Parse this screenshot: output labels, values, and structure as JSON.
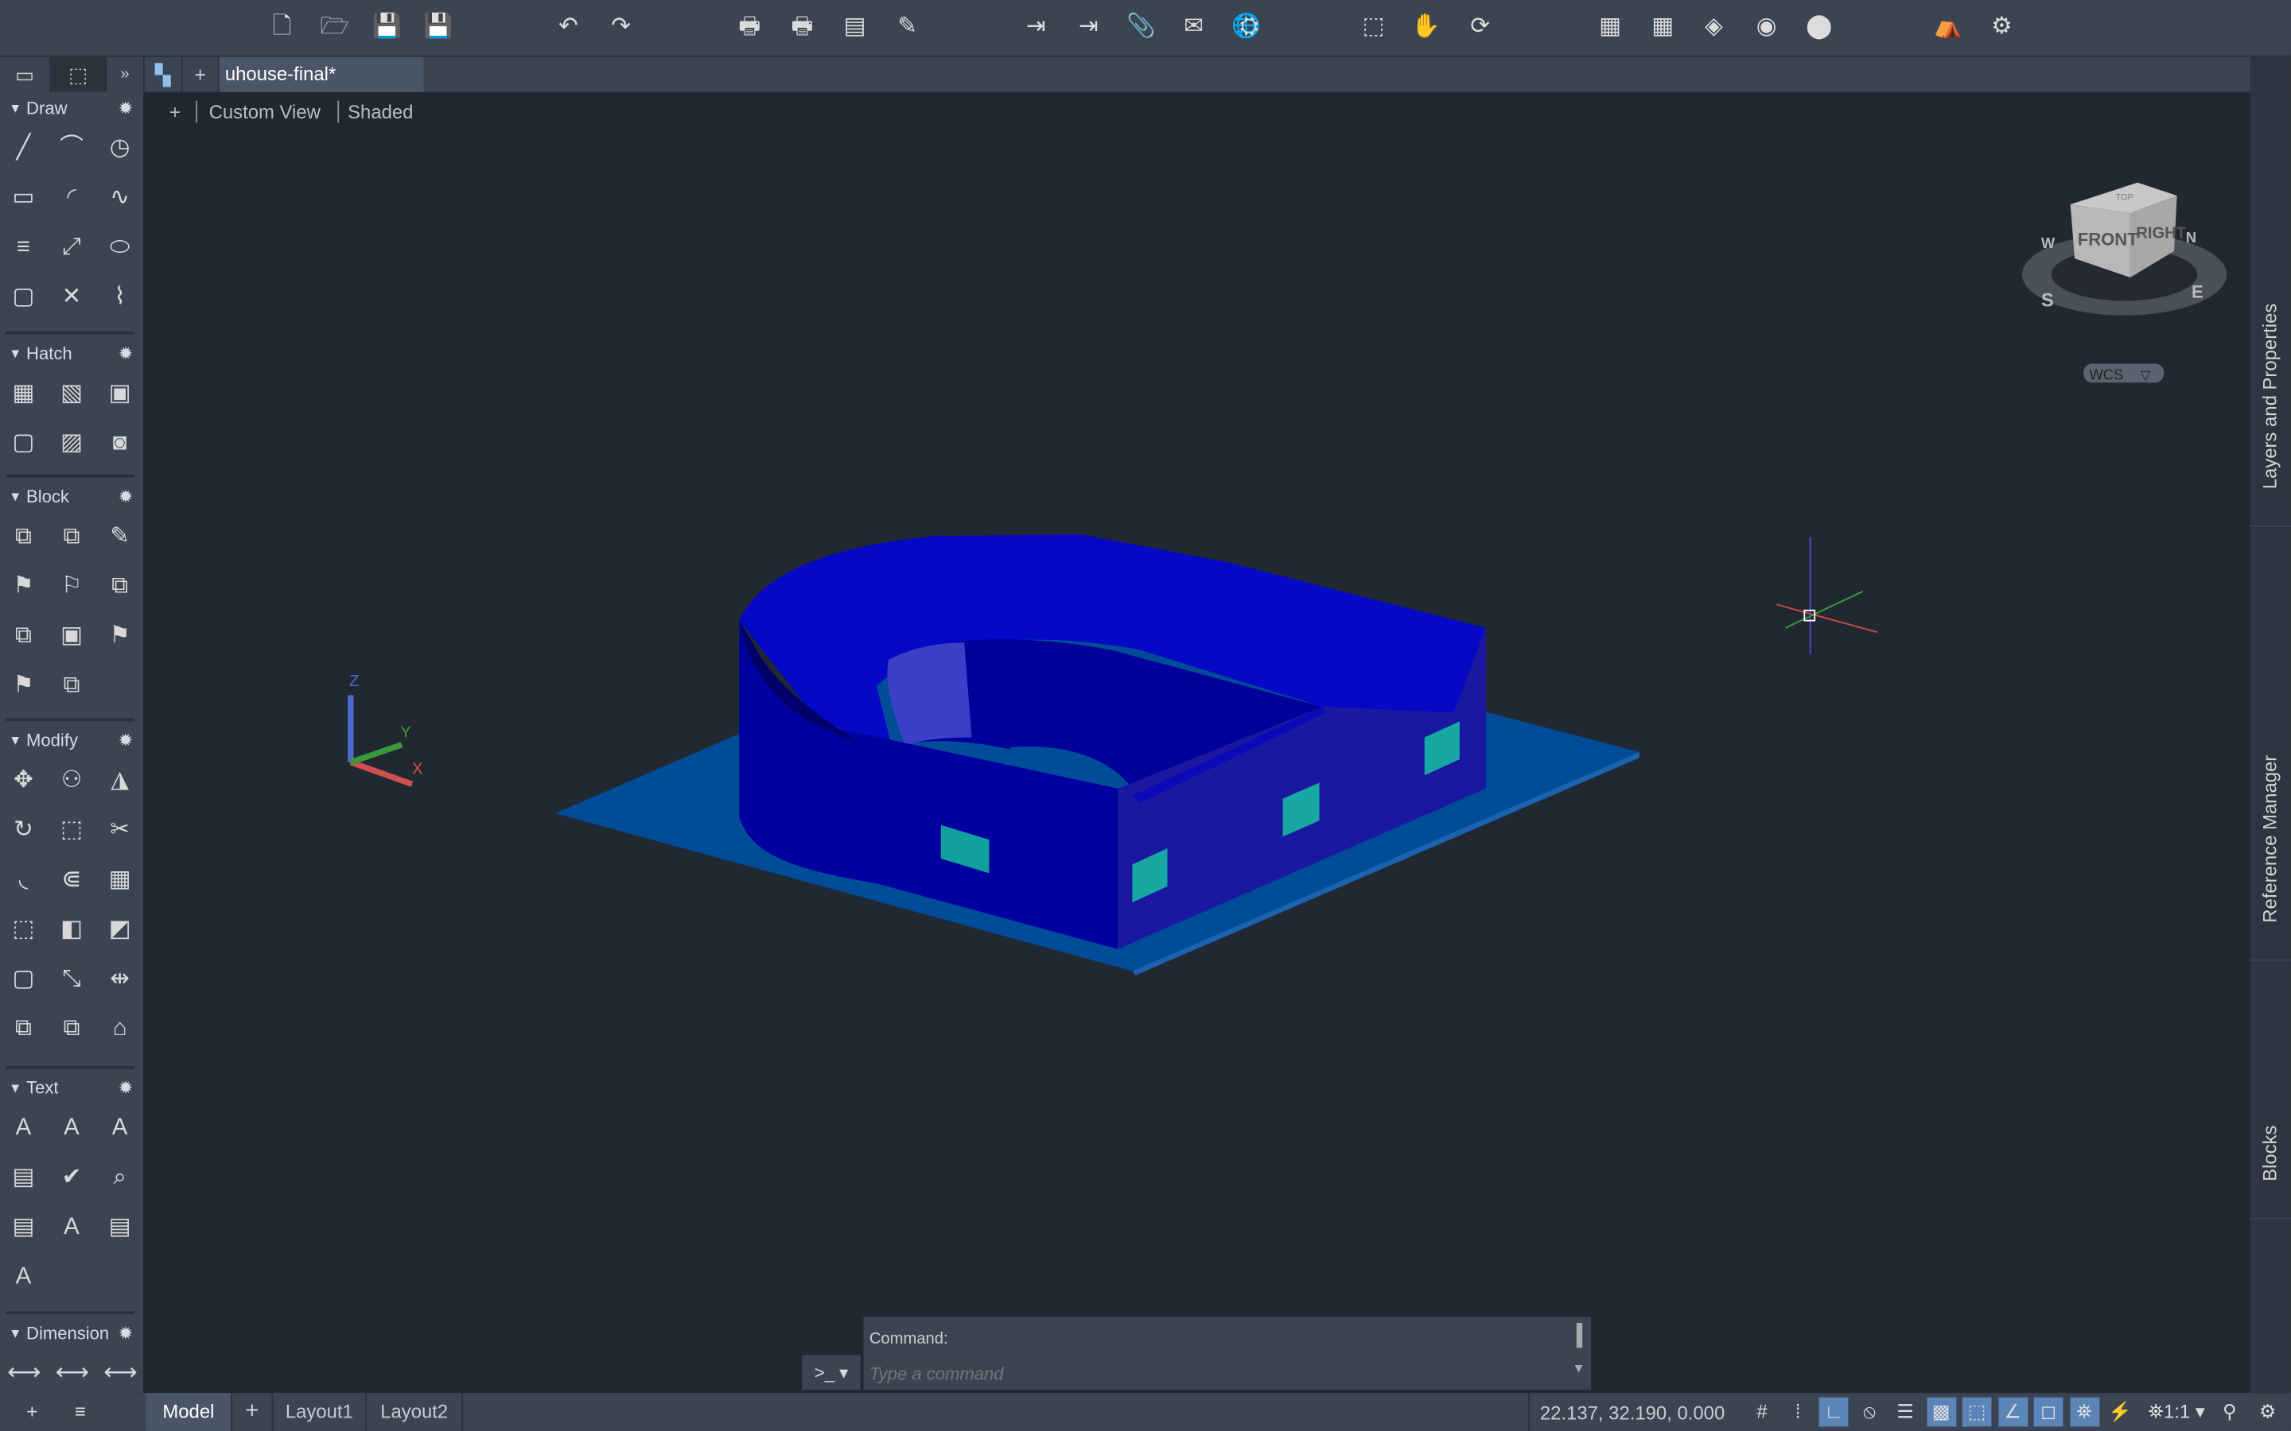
{
  "toolbar": {
    "icons": [
      "new-file",
      "open-file",
      "save",
      "save-as",
      "undo",
      "redo",
      "plot",
      "batch-plot",
      "page-setup",
      "plot-style-editor",
      "import",
      "export",
      "attach",
      "etransmit",
      "publish-web",
      "share",
      "zoom-window",
      "pan",
      "orbit",
      "properties",
      "match-properties",
      "layer-states",
      "layer-manager",
      "color-book",
      "render",
      "render-settings"
    ]
  },
  "tabs": {
    "document": "uhouse-final*",
    "add": "+"
  },
  "viewport": {
    "view_control": "+",
    "view_name": "Custom View",
    "visual_style": "Shaded",
    "wcs": "WCS",
    "viewcube": {
      "front": "FRONT",
      "right": "RIGHT",
      "top": "TOP",
      "north": "N",
      "south": "S",
      "east": "E",
      "west": "W"
    },
    "ucs": {
      "x": "X",
      "y": "Y",
      "z": "Z"
    }
  },
  "palette": {
    "sections": [
      {
        "title": "Draw",
        "icons": [
          "line-icon",
          "polyline-icon",
          "circle-icon",
          "rectangle-icon",
          "arc-icon",
          "spline-icon",
          "multiline-icon",
          "ray-icon",
          "ellipse-icon",
          "rounded-rect-icon",
          "construction-line-icon",
          "revcloud-icon"
        ]
      },
      {
        "title": "Hatch",
        "icons": [
          "hatch-icon",
          "gradient-icon",
          "boundary-icon",
          "region-icon",
          "wipeout-icon",
          "fill-icon"
        ]
      },
      {
        "title": "Block",
        "icons": [
          "create-block-icon",
          "insert-block-icon",
          "edit-block-icon",
          "define-attribute-icon",
          "attribute-tag-icon",
          "block-attribute-manager-icon",
          "write-block-icon",
          "base-point-icon",
          "sync-attributes-icon",
          "edit-attribute-icon",
          "attribute-extract-icon"
        ]
      },
      {
        "title": "Modify",
        "icons": [
          "move-icon",
          "copy-icon",
          "mirror-icon",
          "rotate-icon",
          "stretch-icon",
          "trim-icon",
          "fillet-icon",
          "offset-icon",
          "array-icon",
          "3d-box-icon",
          "align-icon",
          "draworder-icon",
          "scale-icon",
          "extend-icon",
          "join-icon",
          "edit-reference-icon",
          "copy-reference-icon",
          "erase-icon"
        ]
      },
      {
        "title": "Text",
        "icons": [
          "text-icon",
          "text-style-icon",
          "annotative-text-icon",
          "mtext-icon",
          "spellcheck-icon",
          "find-icon",
          "table-text-icon",
          "update-fields-icon",
          "pdf-import-icon",
          "pdf-text-icon"
        ]
      },
      {
        "title": "Dimension",
        "icons": [
          "quick-dimension-icon",
          "dimension-style-icon",
          "linear-dimension-icon"
        ]
      }
    ]
  },
  "right_panel": {
    "tabs": [
      "Layers and Properties",
      "Reference Manager",
      "Blocks"
    ]
  },
  "command": {
    "history": "Command:",
    "placeholder": "Type a command",
    "prompt": ">_ ▾"
  },
  "layout_tabs": [
    "Model",
    "Layout1",
    "Layout2"
  ],
  "status": {
    "coordinates": "22.137, 32.190, 0.000",
    "annotation_scale": "1:1 ▾"
  },
  "colors": {
    "wall": "#0000a0",
    "roof": "#0508c4",
    "side": "#1a18a0",
    "base": "#004c98",
    "window": "#14a3a0"
  }
}
